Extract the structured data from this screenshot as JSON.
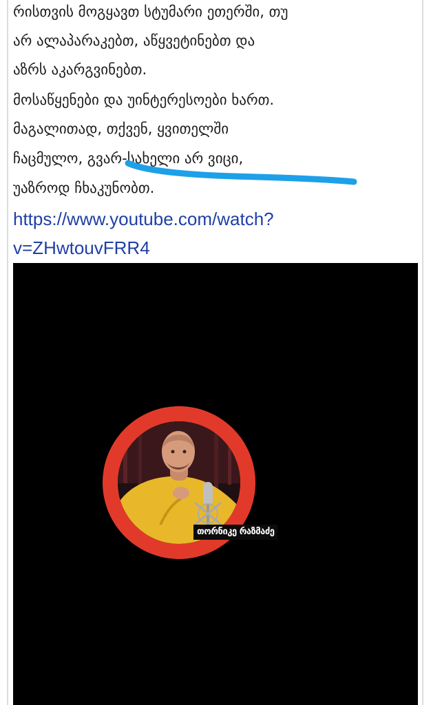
{
  "post": {
    "lines": [
      "რისთვის მოგყავთ სტუმარი ეთერში, თუ",
      "არ ალაპარაკებთ, აწყვეტინებთ და",
      "აზრს აკარგვინებთ.",
      "მოსაწყენები და უინტერესოები ხართ.",
      "მაგალითად, თქვენ, ყვითელში",
      "ჩაცმულო, გვარ-სახელი არ ვიცი,",
      "უაზროდ ჩხაკუნობთ."
    ],
    "link_line_1": "https://www.youtube.com/watch?",
    "link_line_2": "v=ZHwtouvFRR4"
  },
  "video": {
    "overlay_name": "თორნიკე რაზმაძე",
    "ring_color": "#e23a2a",
    "shirt_color": "#e9b82a"
  },
  "annotation": {
    "marker_color": "#1ea0e8"
  }
}
